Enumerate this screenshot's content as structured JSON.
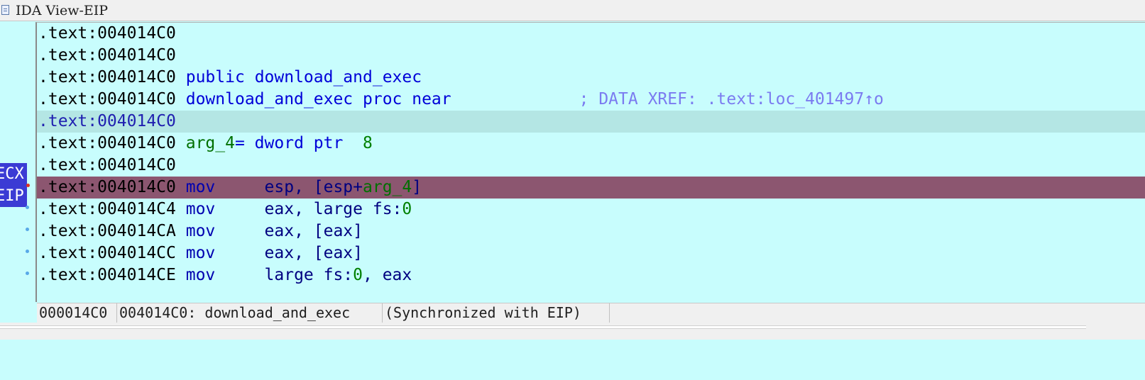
{
  "window": {
    "title": "IDA View-EIP",
    "icon": "document-icon"
  },
  "gutter": {
    "register_tags": [
      "ECX",
      "EIP"
    ],
    "colors": {
      "tag_bg": "#3b3bd4",
      "tag_fg": "#ffffff",
      "breakpoint_dot": "#e03020",
      "flow_dot": "#58a8e8"
    }
  },
  "listing": {
    "lines": [
      {
        "addr": ".text:004014C0"
      },
      {
        "addr": ".text:004014C0"
      },
      {
        "addr": ".text:004014C0",
        "kw1": "public",
        "name": "download_and_exec"
      },
      {
        "addr": ".text:004014C0",
        "name": "download_and_exec",
        "kw2": "proc near",
        "comment": "; DATA XREF: .text:loc_401497↑o"
      },
      {
        "addr": ".text:004014C0"
      },
      {
        "addr": ".text:004014C0",
        "var": "arg_4",
        "rest": "= dword ptr  ",
        "num": "8"
      },
      {
        "addr": ".text:004014C0"
      },
      {
        "addr": ".text:004014C0",
        "mnem": "mov",
        "op_a": "esp, [esp+",
        "op_var": "arg_4",
        "op_b": "]"
      },
      {
        "addr": ".text:004014C4",
        "mnem": "mov",
        "op_a": "eax, large fs:",
        "op_num": "0"
      },
      {
        "addr": ".text:004014CA",
        "mnem": "mov",
        "op_a": "eax, [eax]"
      },
      {
        "addr": ".text:004014CC",
        "mnem": "mov",
        "op_a": "eax, [eax]"
      },
      {
        "addr": ".text:004014CE",
        "mnem": "mov",
        "op_a": "large fs:",
        "op_num": "0",
        "op_b": ", eax"
      }
    ],
    "colors": {
      "background": "#c8fdfd",
      "cursor_line": "#b4e6e4",
      "eip_line": "#8c5670",
      "keyword": "#0000d8",
      "number": "#008000",
      "comment": "#7b7bf0"
    }
  },
  "status": {
    "offset": "000014C0",
    "location": "004014C0: download_and_exec",
    "sync": "(Synchronized with EIP)"
  }
}
